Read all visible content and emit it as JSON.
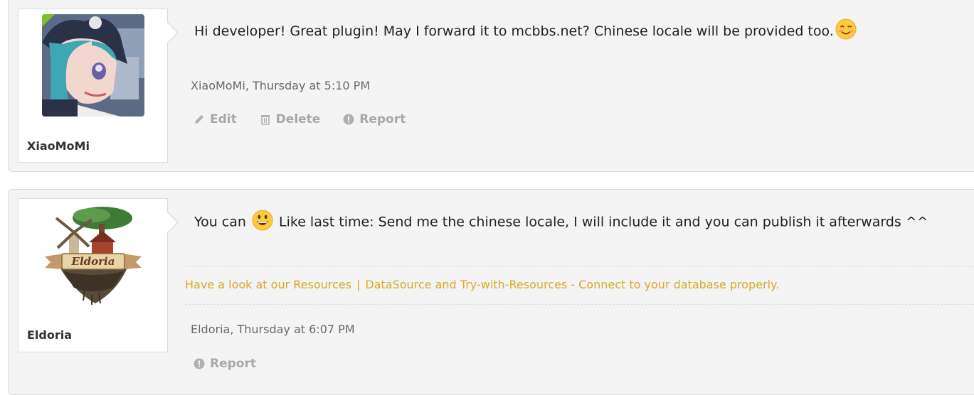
{
  "posts": [
    {
      "username": "XiaoMoMi",
      "message": "Hi developer!  Great plugin!  May I forward it to mcbbs.net?  Chinese locale will be provided too.",
      "emoji": "smiling-face-emoji",
      "meta": "XiaoMoMi, Thursday at 5:10 PM",
      "actions": [
        "Edit",
        "Delete",
        "Report"
      ]
    },
    {
      "username": "Eldoria",
      "message_before": "You can",
      "emoji": "grinning-face-emoji",
      "message_after": "Like last time: Send me the chinese locale, I will include it and you can publish it afterwards ^^",
      "signature": {
        "link1": "Have a look at our Resources",
        "separator": "|",
        "link2": "DataSource and Try-with-Resources - Connect to your database properly."
      },
      "logo_text": "Eldoria",
      "meta": "Eldoria, Thursday at 6:07 PM",
      "actions": [
        "Report"
      ]
    }
  ],
  "colors": {
    "link": "#e0a722",
    "muted": "#a8a8a8",
    "online": "#7cbf2f"
  }
}
